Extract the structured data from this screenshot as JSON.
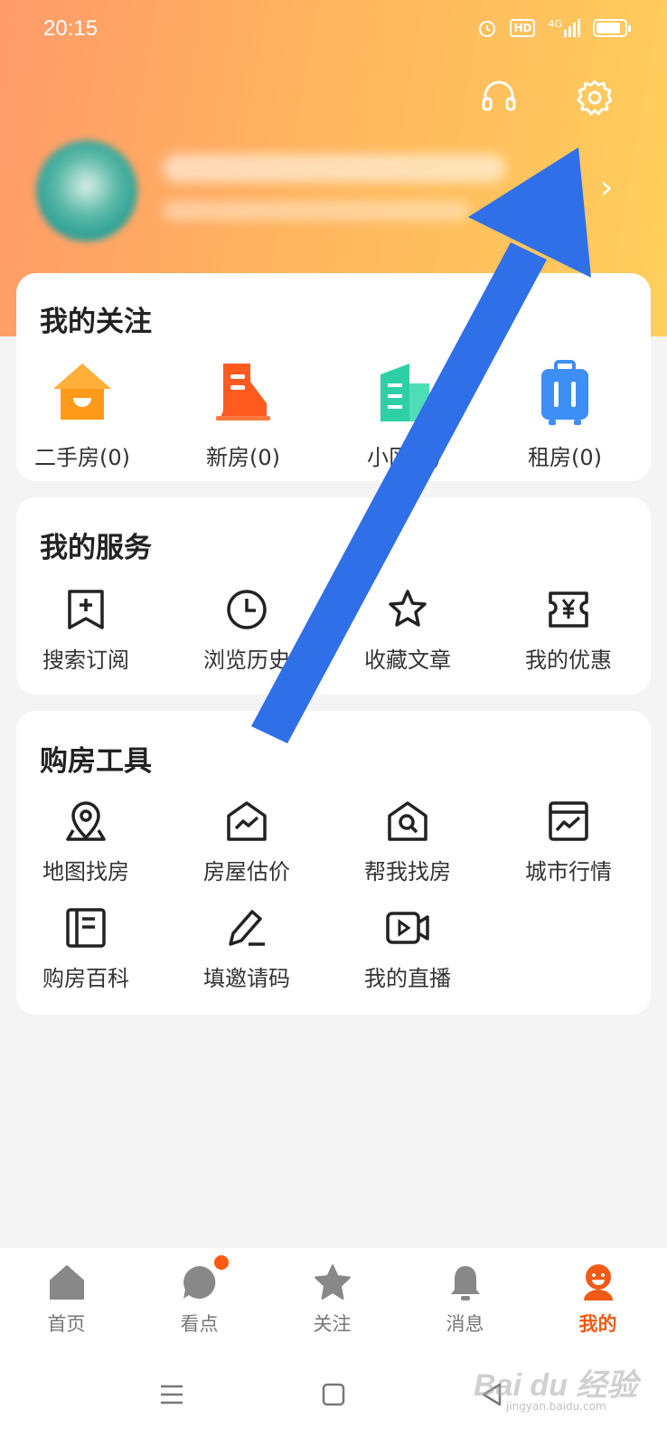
{
  "status_bar": {
    "time": "20:15",
    "network": "4G",
    "hd_label": "HD",
    "battery_level": 0.85
  },
  "header": {
    "support_icon": "headset-icon",
    "settings_icon": "gear-icon",
    "profile_arrow_icon": "chevron-right-icon",
    "gradient_colors": [
      "#ff9a6a",
      "#ffb45e",
      "#ffcf5c"
    ]
  },
  "follow": {
    "title": "我的关注",
    "items": [
      {
        "label": "二手房(0)",
        "icon": "house-icon",
        "color": "#ff9a1a"
      },
      {
        "label": "新房(0)",
        "icon": "building-icon",
        "color": "#ff5a1f"
      },
      {
        "label": "小区(0)",
        "icon": "community-icon",
        "color": "#2fcfa6"
      },
      {
        "label": "租房(0)",
        "icon": "suitcase-icon",
        "color": "#3d8ef5"
      }
    ]
  },
  "services": {
    "title": "我的服务",
    "items": [
      {
        "label": "搜索订阅",
        "icon": "bookmark-plus-icon"
      },
      {
        "label": "浏览历史",
        "icon": "clock-icon"
      },
      {
        "label": "收藏文章",
        "icon": "star-icon"
      },
      {
        "label": "我的优惠",
        "icon": "coupon-icon"
      }
    ]
  },
  "tools": {
    "title": "购房工具",
    "items": [
      {
        "label": "地图找房",
        "icon": "map-pin-icon"
      },
      {
        "label": "房屋估价",
        "icon": "house-chart-icon"
      },
      {
        "label": "帮我找房",
        "icon": "house-search-icon"
      },
      {
        "label": "城市行情",
        "icon": "trend-chart-icon"
      },
      {
        "label": "购房百科",
        "icon": "book-icon"
      },
      {
        "label": "填邀请码",
        "icon": "pencil-icon"
      },
      {
        "label": "我的直播",
        "icon": "video-icon"
      }
    ]
  },
  "tabbar": {
    "items": [
      {
        "label": "首页",
        "icon": "home-icon"
      },
      {
        "label": "看点",
        "icon": "chat-bubble-icon"
      },
      {
        "label": "关注",
        "icon": "star-icon"
      },
      {
        "label": "消息",
        "icon": "bell-icon"
      },
      {
        "label": "我的",
        "icon": "smiley-user-icon"
      }
    ],
    "active_index": 4,
    "active_color": "#f05a14"
  },
  "navbar": {
    "icons": [
      "menu-icon",
      "square-icon",
      "back-triangle-icon"
    ]
  },
  "watermark": {
    "text": "Bai du 经验",
    "sub": "jingyan.baidu.com"
  },
  "annotation": {
    "arrow_color": "#2f6fe8"
  }
}
